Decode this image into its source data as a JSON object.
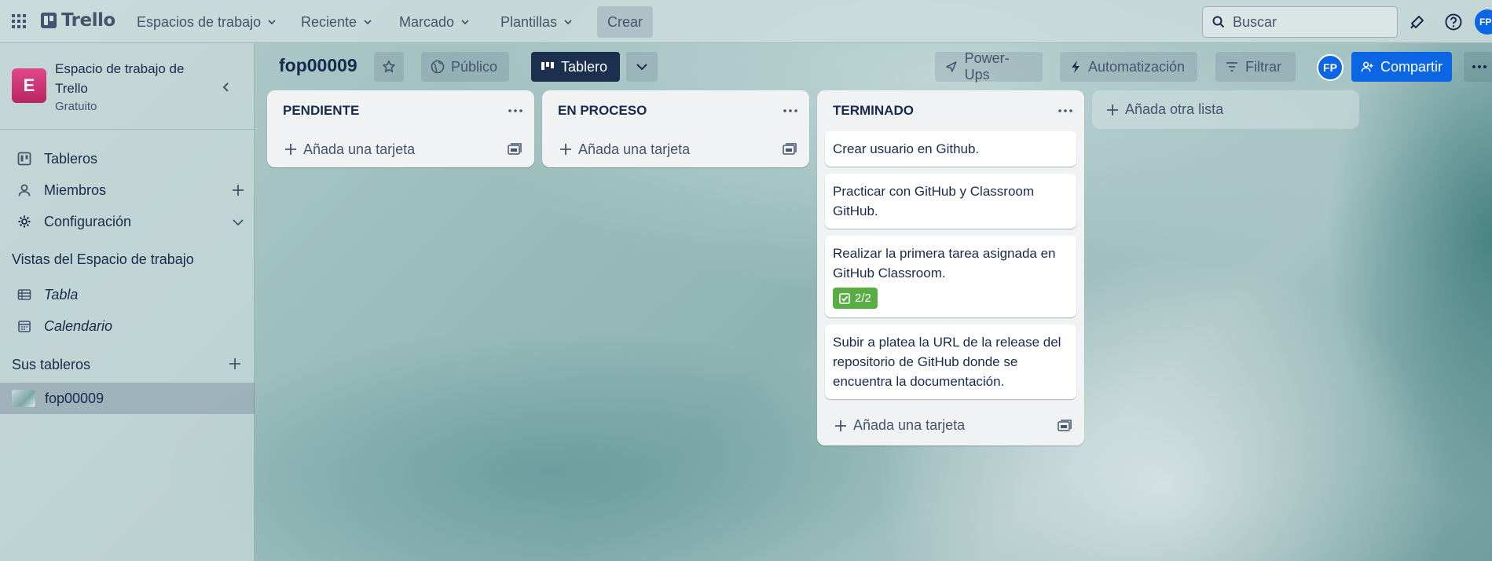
{
  "topbar": {
    "logo_text": "Trello",
    "menus": [
      "Espacios de trabajo",
      "Reciente",
      "Marcado",
      "Plantillas"
    ],
    "create_label": "Crear",
    "search_placeholder": "Buscar",
    "user_initials": "FP"
  },
  "sidebar": {
    "workspace_initial": "E",
    "workspace_name": "Espacio de trabajo de Trello",
    "workspace_plan": "Gratuito",
    "items": [
      {
        "label": "Tableros",
        "icon": "board-icon"
      },
      {
        "label": "Miembros",
        "icon": "person-icon"
      },
      {
        "label": "Configuración",
        "icon": "gear-icon"
      }
    ],
    "views_heading": "Vistas del Espacio de trabajo",
    "views": [
      {
        "label": "Tabla",
        "icon": "table-icon"
      },
      {
        "label": "Calendario",
        "icon": "calendar-icon"
      }
    ],
    "boards_heading": "Sus tableros",
    "boards": [
      {
        "label": "fop00009"
      }
    ]
  },
  "board": {
    "title": "fop00009",
    "visibility": "Público",
    "view": "Tablero",
    "powerups": "Power-Ups",
    "automation": "Automatización",
    "filter": "Filtrar",
    "member_initials": "FP",
    "share": "Compartir"
  },
  "lists": [
    {
      "title": "PENDIENTE",
      "add_card": "Añada una tarjeta",
      "cards": []
    },
    {
      "title": "EN PROCESO",
      "add_card": "Añada una tarjeta",
      "cards": []
    },
    {
      "title": "TERMINADO",
      "add_card": "Añada una tarjeta",
      "cards": [
        {
          "text": "Crear usuario en Github."
        },
        {
          "text": "Practicar con GitHub y Classroom GitHub."
        },
        {
          "text": "Realizar la primera tarea asignada en GitHub Classroom.",
          "checklist": "2/2"
        },
        {
          "text": "Subir a platea la URL de la release del repositorio de GitHub donde se encuentra la documentación."
        }
      ]
    }
  ],
  "add_list_label": "Añada otra lista",
  "colors": {
    "accent": "#0c66e4",
    "header_dark": "#1d2f4f",
    "badge_complete": "#5aac44",
    "workspace_avatar": "#c9377a"
  }
}
